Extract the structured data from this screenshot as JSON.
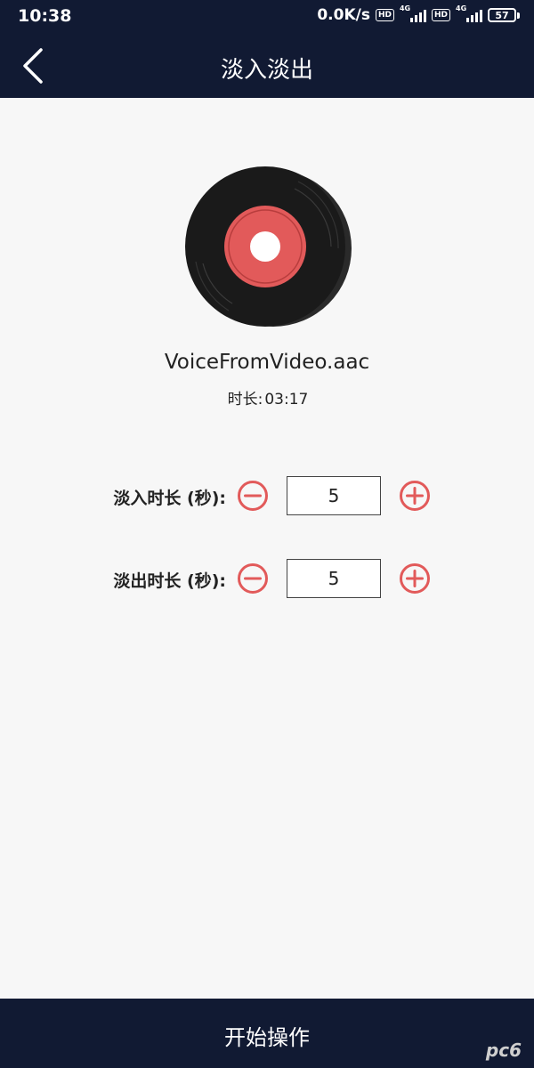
{
  "status_bar": {
    "time": "10:38",
    "net_speed": "0.0K/s",
    "hd_label": "HD",
    "network_type": "4G",
    "battery": "57"
  },
  "header": {
    "title": "淡入淡出",
    "back_icon": "chevron-left-icon"
  },
  "audio": {
    "filename": "VoiceFromVideo.aac",
    "duration_label": "时长:",
    "duration_value": "03:17",
    "icon": "vinyl-record-icon"
  },
  "fade_in": {
    "label": "淡入时长 (秒):",
    "value": "5"
  },
  "fade_out": {
    "label": "淡出时长 (秒):",
    "value": "5"
  },
  "action": {
    "start_label": "开始操作"
  },
  "watermark": "pc6",
  "colors": {
    "bar_bg": "#111a33",
    "accent_red": "#e25a5a",
    "page_bg": "#f7f7f7"
  }
}
